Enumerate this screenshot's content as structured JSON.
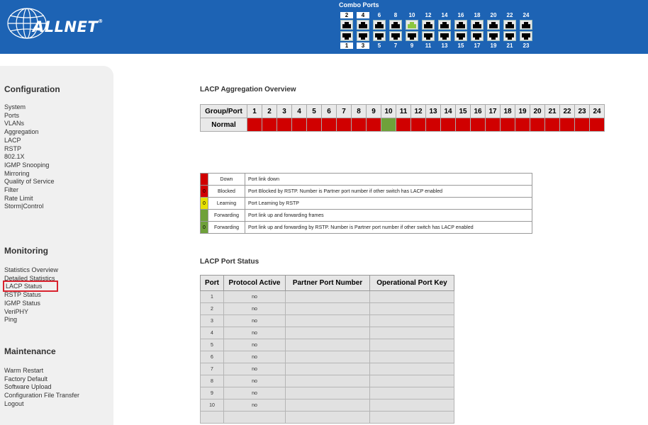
{
  "brand": {
    "name": "ALLNET",
    "reg": "®"
  },
  "header": {
    "combo_label": "Combo Ports",
    "top_numbers": [
      "2",
      "4",
      "6",
      "8",
      "10",
      "12",
      "14",
      "16",
      "18",
      "20",
      "22",
      "24"
    ],
    "bottom_numbers": [
      "1",
      "3",
      "5",
      "7",
      "9",
      "11",
      "13",
      "15",
      "17",
      "19",
      "21",
      "23"
    ],
    "boxed_ports": [
      "1",
      "2",
      "3",
      "4"
    ],
    "active_ports": [
      "10"
    ],
    "active_color": "#8cc63f"
  },
  "sidebar": {
    "sections": [
      {
        "title": "Configuration",
        "items": [
          "System",
          "Ports",
          "VLANs",
          "Aggregation",
          "LACP",
          "RSTP",
          "802.1X",
          "IGMP Snooping",
          "Mirroring",
          "Quality of Service",
          "Filter",
          "Rate Limit",
          "Storm|Control"
        ]
      },
      {
        "title": "Monitoring",
        "items": [
          "Statistics Overview",
          "Detailed Statistics",
          "LACP Status",
          "RSTP Status",
          "IGMP Status",
          "VeriPHY",
          "Ping"
        ]
      },
      {
        "title": "Maintenance",
        "items": [
          "Warm Restart",
          "Factory Default",
          "Software Upload",
          "Configuration File Transfer",
          "Logout"
        ]
      }
    ],
    "selected": "LACP Status",
    "selected_color": "#d9232e"
  },
  "aggregation": {
    "title": "LACP Aggregation Overview",
    "header_label": "Group/Port",
    "ports": [
      "1",
      "2",
      "3",
      "4",
      "5",
      "6",
      "7",
      "8",
      "9",
      "10",
      "11",
      "12",
      "13",
      "14",
      "15",
      "16",
      "17",
      "18",
      "19",
      "20",
      "21",
      "22",
      "23",
      "24"
    ],
    "row_label": "Normal",
    "row_states": [
      "down",
      "down",
      "down",
      "down",
      "down",
      "down",
      "down",
      "down",
      "down",
      "up",
      "down",
      "down",
      "down",
      "down",
      "down",
      "down",
      "down",
      "down",
      "down",
      "down",
      "down",
      "down",
      "down",
      "down"
    ],
    "colors": {
      "down": "#d00000",
      "up": "#6fa13a"
    }
  },
  "legend": [
    {
      "swatch": "",
      "color": "#d00000",
      "state": "Down",
      "desc": "Port link down"
    },
    {
      "swatch": "0",
      "color": "#d00000",
      "state": "Blocked",
      "desc": "Port Blocked by RSTP. Number is Partner port number if other switch has LACP enabled"
    },
    {
      "swatch": "0",
      "color": "#e6e000",
      "state": "Learning",
      "desc": "Port Learning by RSTP"
    },
    {
      "swatch": "",
      "color": "#6fa13a",
      "state": "Forwarding",
      "desc": "Port link up and forwarding frames"
    },
    {
      "swatch": "0",
      "color": "#6fa13a",
      "state": "Forwarding",
      "desc": "Port link up and forwarding by RSTP. Number is Partner port number if other switch has LACP enabled"
    }
  ],
  "port_status": {
    "title": "LACP Port Status",
    "columns": [
      "Port",
      "Protocol Active",
      "Partner Port Number",
      "Operational Port Key"
    ],
    "rows": [
      {
        "port": "1",
        "active": "no",
        "partner": "",
        "key": ""
      },
      {
        "port": "2",
        "active": "no",
        "partner": "",
        "key": ""
      },
      {
        "port": "3",
        "active": "no",
        "partner": "",
        "key": ""
      },
      {
        "port": "4",
        "active": "no",
        "partner": "",
        "key": ""
      },
      {
        "port": "5",
        "active": "no",
        "partner": "",
        "key": ""
      },
      {
        "port": "6",
        "active": "no",
        "partner": "",
        "key": ""
      },
      {
        "port": "7",
        "active": "no",
        "partner": "",
        "key": ""
      },
      {
        "port": "8",
        "active": "no",
        "partner": "",
        "key": ""
      },
      {
        "port": "9",
        "active": "no",
        "partner": "",
        "key": ""
      },
      {
        "port": "10",
        "active": "no",
        "partner": "",
        "key": ""
      },
      {
        "port": "",
        "active": "",
        "partner": "",
        "key": ""
      }
    ]
  }
}
